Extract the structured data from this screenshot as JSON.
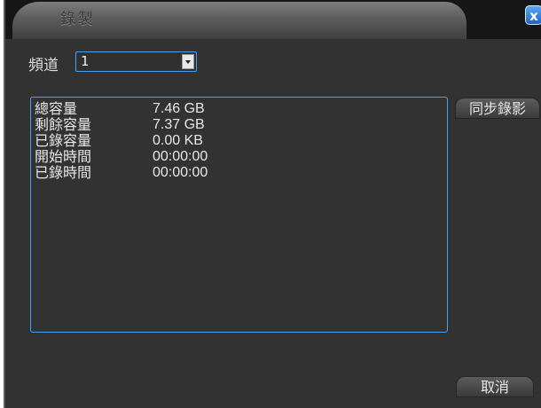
{
  "window": {
    "title": "錄製",
    "close_label": "x"
  },
  "channel": {
    "label": "頻道",
    "value": "1"
  },
  "info": {
    "rows": [
      {
        "label": "總容量",
        "value": "7.46 GB"
      },
      {
        "label": "剩餘容量",
        "value": "7.37 GB"
      },
      {
        "label": "已錄容量",
        "value": "0.00 KB"
      },
      {
        "label": "開始時間",
        "value": "00:00:00"
      },
      {
        "label": "已錄時間",
        "value": "00:00:00"
      }
    ]
  },
  "buttons": {
    "sync_label": "同步錄影",
    "cancel_label": "取消"
  },
  "colors": {
    "accent": "#4b9ff2",
    "background": "#323232",
    "close_button": "#2f7ee0"
  }
}
